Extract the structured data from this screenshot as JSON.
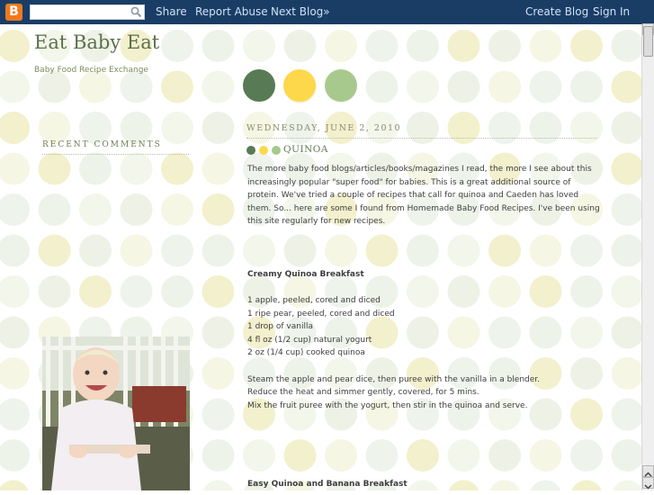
{
  "navbar": {
    "logo_glyph": "B",
    "search_placeholder": "",
    "links_left": [
      "Share",
      "Report Abuse",
      "Next Blog»"
    ],
    "links_right": [
      "Create Blog",
      "Sign In"
    ],
    "bg_color": "#1a3d66",
    "link_color": "#cfe0f4"
  },
  "header": {
    "title": "Eat Baby Eat",
    "description": "Baby Food Recipe Exchange"
  },
  "palette": {
    "dark_green": "#587a54",
    "yellow": "#fcd84a",
    "light_green": "#a8c98d"
  },
  "sidebar": {
    "recent_comments_heading": "RECENT COMMENTS"
  },
  "post": {
    "date": "WEDNESDAY, JUNE 2, 2010",
    "title": "QUINOA",
    "intro": "The more baby food blogs/articles/books/magazines I read, the more I see about this increasingly popular \"super food\" for babies. This is a great additional source of protein. We've tried a couple of recipes that call for quinoa and Caeden has loved them. So... here are some I found from Homemade Baby Food Recipes. I've been using this site regularly for new recipes.",
    "recipe1_title": "Creamy Quinoa Breakfast",
    "recipe1_ingredients": [
      "1 apple, peeled, cored and diced",
      "1 ripe pear, peeled, cored and diced",
      "1 drop of vanilla",
      "4 fl oz (1/2 cup) natural yogurt",
      "2 oz (1/4 cup) cooked quinoa"
    ],
    "recipe1_steps": [
      "Steam the apple and pear dice, then puree with the vanilla in a blender.",
      "Reduce the heat and simmer gently, covered, for 5 mins.",
      "Mix the fruit puree with the yogurt, then stir in the quinoa and serve."
    ],
    "recipe2_title": "Easy Quinoa and Banana Breakfast"
  }
}
